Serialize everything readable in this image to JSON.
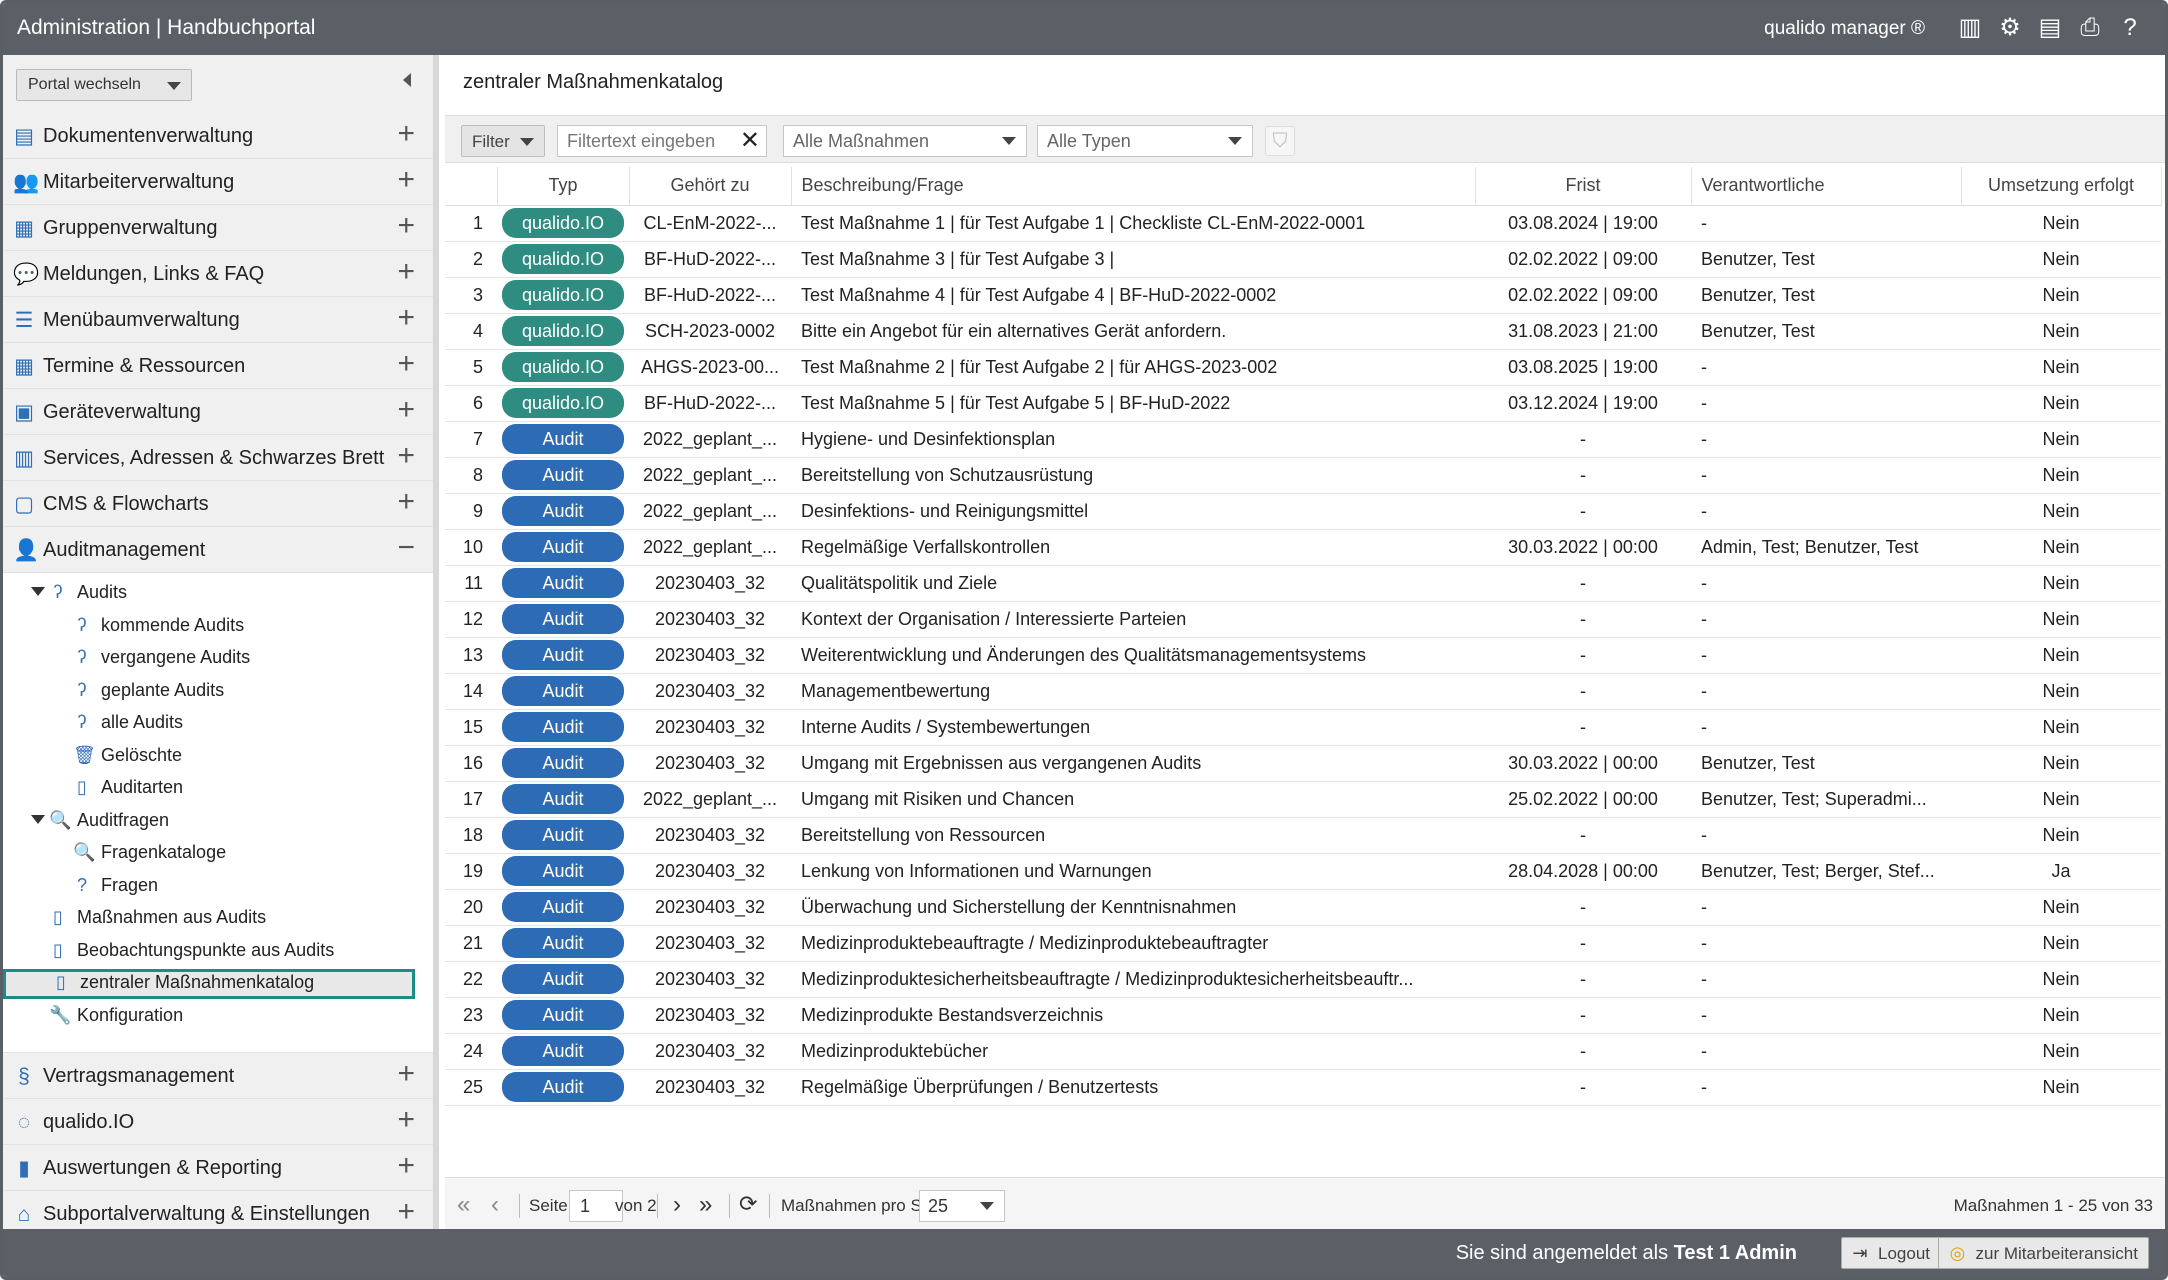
{
  "topbar": {
    "title": "Administration | Handbuchportal",
    "brand": "qualido manager ®",
    "tools": [
      {
        "icon": "barcode-icon",
        "glyph": "▥"
      },
      {
        "icon": "settings-cogs-icon",
        "glyph": "⚙"
      },
      {
        "icon": "xls-export-icon",
        "glyph": "▤"
      },
      {
        "icon": "print-icon",
        "glyph": "⎙"
      },
      {
        "icon": "help-icon",
        "glyph": "?"
      }
    ]
  },
  "sidebar": {
    "portal_switch": "Portal wechseln",
    "menu": [
      {
        "label": "Dokumentenverwaltung",
        "icon": "documents-icon",
        "glyph": "▤"
      },
      {
        "label": "Mitarbeiterverwaltung",
        "icon": "users-icon",
        "glyph": "👥"
      },
      {
        "label": "Gruppenverwaltung",
        "icon": "group-edit-icon",
        "glyph": "▦"
      },
      {
        "label": "Meldungen, Links & FAQ",
        "icon": "speech-bubble-icon",
        "glyph": "💬"
      },
      {
        "label": "Menübaumverwaltung",
        "icon": "list-icon",
        "glyph": "☰"
      },
      {
        "label": "Termine & Ressourcen",
        "icon": "calendar-icon",
        "glyph": "▦"
      },
      {
        "label": "Geräteverwaltung",
        "icon": "device-icon",
        "glyph": "▣"
      },
      {
        "label": "Services, Adressen & Schwarzes Brett",
        "icon": "address-book-icon",
        "glyph": "▥"
      },
      {
        "label": "CMS & Flowcharts",
        "icon": "cms-icon",
        "glyph": "▢"
      },
      {
        "label": "Auditmanagement",
        "icon": "auditor-icon",
        "glyph": "👤"
      }
    ],
    "tree": [
      {
        "label": "Audits",
        "icon": "ear-icon",
        "glyph": "ʔ"
      },
      {
        "label": "kommende Audits",
        "icon": "ear-icon",
        "glyph": "ʔ"
      },
      {
        "label": "vergangene Audits",
        "icon": "ear-icon",
        "glyph": "ʔ"
      },
      {
        "label": "geplante Audits",
        "icon": "ear-icon",
        "glyph": "ʔ"
      },
      {
        "label": "alle Audits",
        "icon": "ear-icon",
        "glyph": "ʔ"
      },
      {
        "label": "Gelöschte",
        "icon": "trash-icon",
        "glyph": "🗑"
      },
      {
        "label": "Auditarten",
        "icon": "document-icon",
        "glyph": "▯"
      },
      {
        "label": "Auditfragen",
        "icon": "magnifier-icon",
        "glyph": "🔍"
      },
      {
        "label": "Fragenkataloge",
        "icon": "magnifier-icon",
        "glyph": "🔍"
      },
      {
        "label": "Fragen",
        "icon": "question-doc-icon",
        "glyph": "?"
      },
      {
        "label": "Maßnahmen aus Audits",
        "icon": "checklist-icon",
        "glyph": "▯"
      },
      {
        "label": "Beobachtungspunkte aus Audits",
        "icon": "checklist-icon",
        "glyph": "▯"
      },
      {
        "label": "zentraler Maßnahmenkatalog",
        "icon": "checklist-icon",
        "glyph": "▯"
      },
      {
        "label": "Konfiguration",
        "icon": "wrench-icon",
        "glyph": "🔧"
      }
    ],
    "menu_bottom": [
      {
        "label": "Vertragsmanagement",
        "icon": "paragraph-icon",
        "glyph": "§"
      },
      {
        "label": "qualido.IO",
        "icon": "qualido-io-icon",
        "glyph": "◌"
      },
      {
        "label": "Auswertungen & Reporting",
        "icon": "bar-chart-icon",
        "glyph": "▮"
      },
      {
        "label": "Subportalverwaltung & Einstellungen",
        "icon": "home-icon",
        "glyph": "⌂"
      }
    ]
  },
  "main": {
    "breadcrumb": "zentraler Maßnahmenkatalog",
    "filter": {
      "button": "Filter",
      "placeholder": "Filtertext eingeben",
      "select_measures": "Alle Maßnahmen",
      "select_types": "Alle Typen"
    },
    "columns": [
      "",
      "Typ",
      "Gehört zu",
      "Beschreibung/Frage",
      "Frist",
      "Verantwortliche",
      "Umsetzung erfolgt"
    ],
    "rows": [
      {
        "n": "1",
        "type": "qualido.IO",
        "belongs": "CL-EnM-2022-...",
        "desc": "Test Maßnahme 1 | für Test Aufgabe 1 | Checkliste CL-EnM-2022-0001",
        "deadline": "03.08.2024 | 19:00",
        "resp": "-",
        "done": "Nein"
      },
      {
        "n": "2",
        "type": "qualido.IO",
        "belongs": "BF-HuD-2022-...",
        "desc": "Test Maßnahme 3 | für Test Aufgabe 3 |",
        "deadline": "02.02.2022 | 09:00",
        "resp": "Benutzer, Test",
        "done": "Nein"
      },
      {
        "n": "3",
        "type": "qualido.IO",
        "belongs": "BF-HuD-2022-...",
        "desc": "Test Maßnahme 4 | für Test Aufgabe 4 | BF-HuD-2022-0002",
        "deadline": "02.02.2022 | 09:00",
        "resp": "Benutzer, Test",
        "done": "Nein"
      },
      {
        "n": "4",
        "type": "qualido.IO",
        "belongs": "SCH-2023-0002",
        "desc": "Bitte ein Angebot für ein alternatives Gerät anfordern.",
        "deadline": "31.08.2023 | 21:00",
        "resp": "Benutzer, Test",
        "done": "Nein"
      },
      {
        "n": "5",
        "type": "qualido.IO",
        "belongs": "AHGS-2023-00...",
        "desc": "Test Maßnahme 2 | für Test Aufgabe 2 | für AHGS-2023-002",
        "deadline": "03.08.2025 | 19:00",
        "resp": "-",
        "done": "Nein"
      },
      {
        "n": "6",
        "type": "qualido.IO",
        "belongs": "BF-HuD-2022-...",
        "desc": "Test Maßnahme 5 | für Test Aufgabe 5 | BF-HuD-2022",
        "deadline": "03.12.2024 | 19:00",
        "resp": "-",
        "done": "Nein"
      },
      {
        "n": "7",
        "type": "Audit",
        "belongs": "2022_geplant_...",
        "desc": "Hygiene- und Desinfektionsplan",
        "deadline": "-",
        "resp": "-",
        "done": "Nein"
      },
      {
        "n": "8",
        "type": "Audit",
        "belongs": "2022_geplant_...",
        "desc": "Bereitstellung von Schutzausrüstung",
        "deadline": "-",
        "resp": "-",
        "done": "Nein"
      },
      {
        "n": "9",
        "type": "Audit",
        "belongs": "2022_geplant_...",
        "desc": "Desinfektions- und Reinigungsmittel",
        "deadline": "-",
        "resp": "-",
        "done": "Nein"
      },
      {
        "n": "10",
        "type": "Audit",
        "belongs": "2022_geplant_...",
        "desc": "Regelmäßige Verfallskontrollen",
        "deadline": "30.03.2022 | 00:00",
        "resp": "Admin, Test; Benutzer, Test",
        "done": "Nein"
      },
      {
        "n": "11",
        "type": "Audit",
        "belongs": "20230403_32",
        "desc": "Qualitätspolitik und Ziele",
        "deadline": "-",
        "resp": "-",
        "done": "Nein"
      },
      {
        "n": "12",
        "type": "Audit",
        "belongs": "20230403_32",
        "desc": "Kontext der Organisation / Interessierte Parteien",
        "deadline": "-",
        "resp": "-",
        "done": "Nein"
      },
      {
        "n": "13",
        "type": "Audit",
        "belongs": "20230403_32",
        "desc": "Weiterentwicklung und Änderungen des Qualitätsmanagementsystems",
        "deadline": "-",
        "resp": "-",
        "done": "Nein"
      },
      {
        "n": "14",
        "type": "Audit",
        "belongs": "20230403_32",
        "desc": "Managementbewertung",
        "deadline": "-",
        "resp": "-",
        "done": "Nein"
      },
      {
        "n": "15",
        "type": "Audit",
        "belongs": "20230403_32",
        "desc": "Interne Audits / Systembewertungen",
        "deadline": "-",
        "resp": "-",
        "done": "Nein"
      },
      {
        "n": "16",
        "type": "Audit",
        "belongs": "20230403_32",
        "desc": "Umgang mit Ergebnissen aus vergangenen Audits",
        "deadline": "30.03.2022 | 00:00",
        "resp": "Benutzer, Test",
        "done": "Nein"
      },
      {
        "n": "17",
        "type": "Audit",
        "belongs": "2022_geplant_...",
        "desc": "Umgang mit Risiken und Chancen",
        "deadline": "25.02.2022 | 00:00",
        "resp": "Benutzer, Test; Superadmi...",
        "done": "Nein"
      },
      {
        "n": "18",
        "type": "Audit",
        "belongs": "20230403_32",
        "desc": "Bereitstellung von Ressourcen",
        "deadline": "-",
        "resp": "-",
        "done": "Nein"
      },
      {
        "n": "19",
        "type": "Audit",
        "belongs": "20230403_32",
        "desc": "Lenkung von Informationen und Warnungen",
        "deadline": "28.04.2028 | 00:00",
        "resp": "Benutzer, Test; Berger, Stef...",
        "done": "Ja"
      },
      {
        "n": "20",
        "type": "Audit",
        "belongs": "20230403_32",
        "desc": "Überwachung und Sicherstellung der Kenntnisnahmen",
        "deadline": "-",
        "resp": "-",
        "done": "Nein"
      },
      {
        "n": "21",
        "type": "Audit",
        "belongs": "20230403_32",
        "desc": "Medizinproduktebeauftragte / Medizinproduktebeauftragter",
        "deadline": "-",
        "resp": "-",
        "done": "Nein"
      },
      {
        "n": "22",
        "type": "Audit",
        "belongs": "20230403_32",
        "desc": "Medizinproduktesicherheitsbeauftragte / Medizinproduktesicherheitsbeauftr...",
        "deadline": "-",
        "resp": "-",
        "done": "Nein"
      },
      {
        "n": "23",
        "type": "Audit",
        "belongs": "20230403_32",
        "desc": "Medizinprodukte Bestandsverzeichnis",
        "deadline": "-",
        "resp": "-",
        "done": "Nein"
      },
      {
        "n": "24",
        "type": "Audit",
        "belongs": "20230403_32",
        "desc": "Medizinproduktebücher",
        "deadline": "-",
        "resp": "-",
        "done": "Nein"
      },
      {
        "n": "25",
        "type": "Audit",
        "belongs": "20230403_32",
        "desc": "Regelmäßige Überprüfungen / Benutzertests",
        "deadline": "-",
        "resp": "-",
        "done": "Nein"
      }
    ],
    "pager": {
      "page_label": "Seite",
      "page_value": "1",
      "of_label": "von 2",
      "per_page_label": "Maßnahmen pro Seite:",
      "per_page_value": "25",
      "summary": "Maßnahmen 1 - 25 von 33"
    }
  },
  "footer": {
    "logged_in_prefix": "Sie sind angemeldet als",
    "user": "Test 1 Admin",
    "logout": "Logout",
    "employee_view": "zur Mitarbeiteransicht"
  },
  "colors": {
    "topbar": "#5b6067",
    "qualido_pill": "#2f8c80",
    "audit_pill": "#2d6bb5",
    "selection_border": "#1c8c87"
  }
}
